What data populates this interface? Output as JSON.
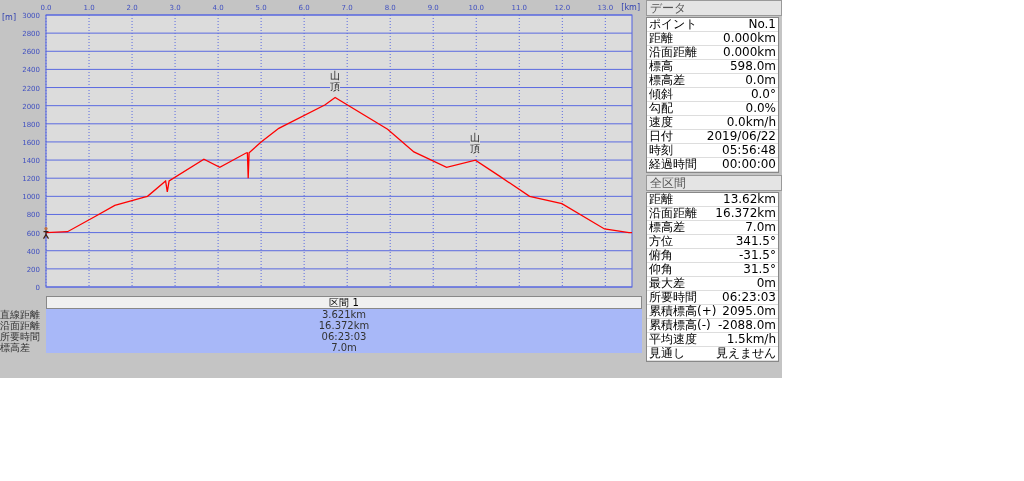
{
  "chart": {
    "chart_data": {
      "type": "line",
      "xlabel": "[km]",
      "ylabel": "[m]",
      "grid": true,
      "x": [
        0,
        0.5,
        1.15,
        1.6,
        2.29,
        2.36,
        2.78,
        2.82,
        2.86,
        3.67,
        4.04,
        4.66,
        4.68,
        4.7,
        4.72,
        5.0,
        5.41,
        6.49,
        6.72,
        7.94,
        8.55,
        9.31,
        9.98,
        10.55,
        11.24,
        11.99,
        12.98,
        13.55,
        13.62
      ],
      "series": [
        {
          "color": "#ff0000",
          "values": [
            600,
            610,
            780,
            900,
            990,
            1000,
            1170,
            1050,
            1170,
            1410,
            1320,
            1480,
            1480,
            1200,
            1480,
            1600,
            1750,
            2010,
            2090,
            1740,
            1490,
            1320,
            1400,
            1220,
            1000,
            920,
            640,
            600,
            600
          ]
        }
      ],
      "xlim": [
        0,
        13.62
      ],
      "ylim": [
        0,
        3000
      ],
      "xticks": [
        {
          "value": 0,
          "label": "0.0"
        },
        {
          "value": 1,
          "label": "1.0"
        },
        {
          "value": 2,
          "label": "2.0"
        },
        {
          "value": 3,
          "label": "3.0"
        },
        {
          "value": 4,
          "label": "4.0"
        },
        {
          "value": 5,
          "label": "5.0"
        },
        {
          "value": 6,
          "label": "6.0"
        },
        {
          "value": 7,
          "label": "7.0"
        },
        {
          "value": 8,
          "label": "8.0"
        },
        {
          "value": 9,
          "label": "9.0"
        },
        {
          "value": 10,
          "label": "10.0"
        },
        {
          "value": 11,
          "label": "11.0"
        },
        {
          "value": 12,
          "label": "12.0"
        },
        {
          "value": 13,
          "label": "13.0"
        }
      ],
      "yticks": [
        0,
        200,
        400,
        600,
        800,
        1000,
        1200,
        1400,
        1600,
        1800,
        2000,
        2200,
        2400,
        2600,
        2800,
        3000
      ],
      "annotations": [
        {
          "x": 6.72,
          "y": 2090,
          "text": "山頂"
        },
        {
          "x": 9.98,
          "y": 1400,
          "text": "山頂"
        }
      ]
    }
  },
  "section_table": {
    "header": "区間 1",
    "rows": [
      {
        "label": "直線距離",
        "value": "3.621km"
      },
      {
        "label": "沿面距離",
        "value": "16.372km"
      },
      {
        "label": "所要時間",
        "value": "06:23:03"
      },
      {
        "label": "標高差",
        "value": "7.0m"
      }
    ]
  },
  "info_panel": {
    "sections": [
      {
        "title": "データ",
        "rows": [
          {
            "label": "ポイント",
            "value": "No.1"
          },
          {
            "label": "距離",
            "value": "0.000km"
          },
          {
            "label": "沿面距離",
            "value": "0.000km"
          },
          {
            "label": "標高",
            "value": "598.0m"
          },
          {
            "label": "標高差",
            "value": "0.0m"
          },
          {
            "label": "傾斜",
            "value": "0.0°"
          },
          {
            "label": "勾配",
            "value": "0.0%"
          },
          {
            "label": "速度",
            "value": "0.0km/h"
          },
          {
            "label": "日付",
            "value": "2019/06/22"
          },
          {
            "label": "時刻",
            "value": "05:56:48"
          },
          {
            "label": "経過時間",
            "value": "00:00:00"
          }
        ]
      },
      {
        "title": "全区間",
        "rows": [
          {
            "label": "距離",
            "value": "13.62km"
          },
          {
            "label": "沿面距離",
            "value": "16.372km"
          },
          {
            "label": "標高差",
            "value": "7.0m"
          },
          {
            "label": "方位",
            "value": "341.5°"
          },
          {
            "label": "俯角",
            "value": "-31.5°"
          },
          {
            "label": "仰角",
            "value": "31.5°"
          },
          {
            "label": "最大差",
            "value": "0m"
          },
          {
            "label": "所要時間",
            "value": "06:23:03"
          },
          {
            "label": "累積標高(+)",
            "value": "2095.0m"
          },
          {
            "label": "累積標高(-)",
            "value": "-2088.0m"
          },
          {
            "label": "平均速度",
            "value": "1.5km/h"
          },
          {
            "label": "見通し",
            "value": "見えません"
          }
        ]
      }
    ]
  }
}
